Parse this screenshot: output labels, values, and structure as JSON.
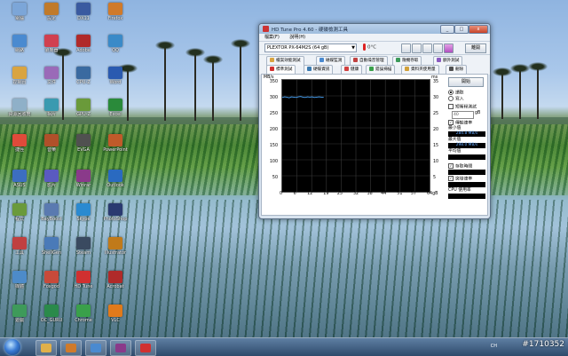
{
  "desktop_icons": [
    {
      "label": "電腦",
      "color": "#7ca6d8"
    },
    {
      "label": "網路",
      "color": "#4a8ad0"
    },
    {
      "label": "控制台",
      "color": "#d9a441"
    },
    {
      "label": "資源回收筒",
      "color": "#8fb0c8"
    },
    {
      "label": "捷徑",
      "color": "#e04a3a"
    },
    {
      "label": "ASUS",
      "color": "#3c6ec0"
    },
    {
      "label": "程式",
      "color": "#6a9a3c"
    },
    {
      "label": "工具",
      "color": "#c04040"
    },
    {
      "label": "媒體",
      "color": "#4d8bc9"
    },
    {
      "label": "遊戲",
      "color": "#3e9a5a"
    },
    {
      "label": "設定",
      "color": "#c07a2a"
    },
    {
      "label": "瀏覽器",
      "color": "#d04050"
    },
    {
      "label": "文件",
      "color": "#9a6ab8"
    },
    {
      "label": "相片",
      "color": "#3a9ab0"
    },
    {
      "label": "音樂",
      "color": "#b0502a"
    },
    {
      "label": "影片",
      "color": "#5a5ac0"
    },
    {
      "label": "BayBoost",
      "color": "#5a7ab0"
    },
    {
      "label": "ShellGen",
      "color": "#4a7ab8"
    },
    {
      "label": "Foxgod",
      "color": "#c84a3a"
    },
    {
      "label": "OC_GURU",
      "color": "#2a8a4a"
    },
    {
      "label": "DX11",
      "color": "#3a5aa0"
    },
    {
      "label": "Adobe",
      "color": "#b02a2a"
    },
    {
      "label": "CPU-Z",
      "color": "#3a6aa0"
    },
    {
      "label": "GPU-Z",
      "color": "#6a9a3a"
    },
    {
      "label": "EVGA",
      "color": "#505050"
    },
    {
      "label": "Winrar",
      "color": "#8a3a8a"
    },
    {
      "label": "Skype",
      "color": "#2a8ad0"
    },
    {
      "label": "Steam",
      "color": "#3a4a60"
    },
    {
      "label": "HD Tune",
      "color": "#d03030"
    },
    {
      "label": "Chrome",
      "color": "#3aa04a"
    },
    {
      "label": "Firefox",
      "color": "#d07a2a"
    },
    {
      "label": "QQ",
      "color": "#3a8ac8"
    },
    {
      "label": "Word",
      "color": "#2a5ab0"
    },
    {
      "label": "Excel",
      "color": "#2a8a3a"
    },
    {
      "label": "PowerPoint",
      "color": "#c05a2a"
    },
    {
      "label": "Outlook",
      "color": "#2a6ac0"
    },
    {
      "label": "PhotoShop",
      "color": "#2a3a70"
    },
    {
      "label": "Illustrator",
      "color": "#c07a1a"
    },
    {
      "label": "Acrobat",
      "color": "#b02a2a"
    },
    {
      "label": "VLC",
      "color": "#e07a1a"
    },
    {
      "label": "Winamp",
      "color": "#d0a02a"
    },
    {
      "label": "iTunes",
      "color": "#8a5ac0"
    },
    {
      "label": "Nero",
      "color": "#202020"
    },
    {
      "label": "Daemon",
      "color": "#c03a3a"
    },
    {
      "label": "UltraISO",
      "color": "#3a7ab0"
    },
    {
      "label": "7-Zip",
      "color": "#2a2a2a"
    },
    {
      "label": "Notepad",
      "color": "#9ab0c8"
    },
    {
      "label": "Paint",
      "color": "#d0a03a"
    },
    {
      "label": "Calc",
      "color": "#505a70"
    },
    {
      "label": "Explorer",
      "color": "#e0b04a"
    }
  ],
  "window": {
    "title": "HD Tune Pro 4.60 - 硬碟檢測工具",
    "minimize": "_",
    "maximize": "□",
    "close": "x",
    "menu": [
      "檔案(F)",
      "說明(H)"
    ],
    "drive": "PLEXTOR PX-64M2S (64 gB)",
    "temperature": "0°C",
    "exit_label": "離開",
    "tabs_row1": [
      {
        "label": "檔案效能測試",
        "color": "#d9a441"
      },
      {
        "label": "磁碟監測",
        "color": "#4a8ad0"
      },
      {
        "label": "自動噪音管理",
        "color": "#c04040"
      },
      {
        "label": "隨機存取",
        "color": "#3c9a5a"
      },
      {
        "label": "額外測試",
        "color": "#8a5ac0"
      }
    ],
    "tabs_row2": [
      {
        "label": "標準測試",
        "color": "#d03030"
      },
      {
        "label": "硬碟資訊",
        "color": "#3a7ab0"
      },
      {
        "label": "健康",
        "color": "#d04040"
      },
      {
        "label": "錯誤掃描",
        "color": "#3aa04a"
      },
      {
        "label": "資料夾使用量",
        "color": "#d0a03a"
      },
      {
        "label": "刪除",
        "color": "#505050"
      }
    ],
    "active_tab": "標準測試"
  },
  "chart_data": {
    "type": "line",
    "left_axis_label": "MB/s",
    "right_axis_label": "ms",
    "left_ticks": [
      "350",
      "300",
      "250",
      "200",
      "150",
      "100",
      "50"
    ],
    "right_ticks": [
      "35",
      "30",
      "25",
      "20",
      "15",
      "10",
      "5"
    ],
    "x_ticks": [
      "0",
      "6",
      "12",
      "19",
      "25",
      "32",
      "38",
      "44",
      "51",
      "57",
      "64gB"
    ],
    "xlim": [
      0,
      64
    ],
    "ylim_left": [
      0,
      350
    ],
    "ylim_right": [
      0,
      35
    ],
    "series": [
      {
        "values_x": [
          0,
          1,
          2,
          3,
          4,
          5,
          6,
          7,
          8,
          9,
          10,
          11,
          12,
          13,
          14,
          15,
          16,
          17,
          18
        ],
        "values_y": [
          295,
          297,
          296,
          294,
          297,
          296,
          295,
          297,
          298,
          296,
          295,
          297,
          296,
          297,
          295,
          296,
          297,
          296,
          296
        ],
        "color": "#4aa8ff"
      }
    ]
  },
  "side": {
    "start_label": "開始",
    "read_label": "讀取",
    "write_label": "寫入",
    "short_stroke_label": "短衝程測試",
    "short_stroke_value": "40",
    "short_stroke_unit": "gB",
    "transfer_rate_label": "傳輸速率",
    "min_label": "最小值",
    "min_value": "284.8 MB/s",
    "max_label": "最大值",
    "max_value": "298.0 MB/s",
    "avg_label": "平均值",
    "avg_value": "",
    "access_time_label": "存取時間",
    "burst_rate_label": "突發速率",
    "cpu_label": "CPU 使用率",
    "access_value": "",
    "burst_value": "",
    "cpu_value": ""
  },
  "taskbar": {
    "items": [
      {
        "name": "explorer",
        "color": "#e0b04a"
      },
      {
        "name": "media",
        "color": "#d07a2a"
      },
      {
        "name": "files",
        "color": "#4a8ad0"
      },
      {
        "name": "winrar",
        "color": "#8a3a8a"
      },
      {
        "name": "hdtune",
        "color": "#d03030"
      }
    ],
    "tray_text": "CH"
  },
  "watermark": "#1710352"
}
